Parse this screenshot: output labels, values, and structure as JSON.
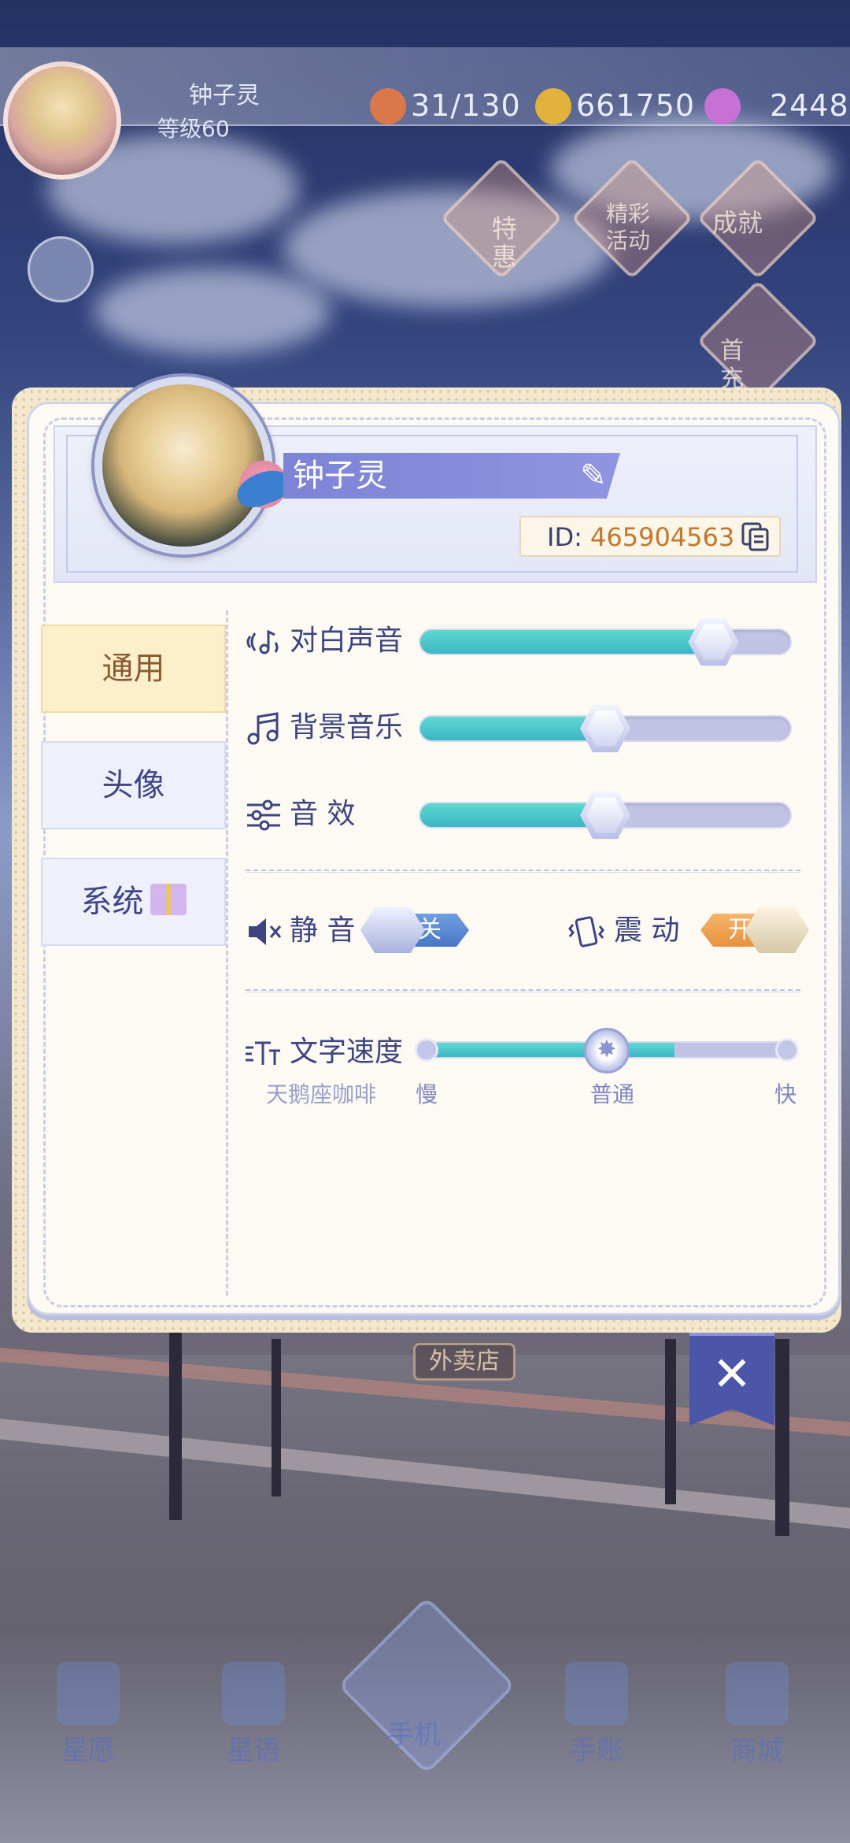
{
  "hud": {
    "player_name": "钟子灵",
    "level": "等级60",
    "stamina": "31/130",
    "coins": "661750",
    "gems": "2448"
  },
  "side_menu": {
    "special": "特惠",
    "events": "精彩活动",
    "achievements": "成就",
    "first_charge": "首充"
  },
  "profile": {
    "name": "钟子灵",
    "id_label": "ID:",
    "id_value": "465904563"
  },
  "tabs": [
    {
      "label": "通用",
      "active": true
    },
    {
      "label": "头像",
      "active": false
    },
    {
      "label": "系统",
      "active": false
    }
  ],
  "sliders": {
    "dialogue_voice": {
      "label": "对白声音",
      "value": 0.79
    },
    "background_music": {
      "label": "背景音乐",
      "value": 0.5
    },
    "sound_effects": {
      "label": "音 效",
      "value": 0.5
    }
  },
  "toggles": {
    "mute": {
      "label": "静 音",
      "state_label": "关",
      "on": false
    },
    "vibration": {
      "label": "震 动",
      "state_label": "开",
      "on": true
    }
  },
  "text_speed": {
    "label": "文字速度",
    "slow": "慢",
    "normal": "普通",
    "fast": "快",
    "value": "普通"
  },
  "watermark": "天鹅座咖啡",
  "scene": {
    "takeout_sign": "外卖店"
  },
  "bottom_nav": [
    "星愿",
    "星语",
    "手机",
    "手账",
    "商城"
  ],
  "colors": {
    "accent_teal": "#3bb6c4",
    "name_bar": "#7d83d6",
    "id_value": "#c4762b",
    "active_tab": "#fcefc9",
    "toggle_on": "#e7913e",
    "toggle_off": "#4a76c6"
  }
}
